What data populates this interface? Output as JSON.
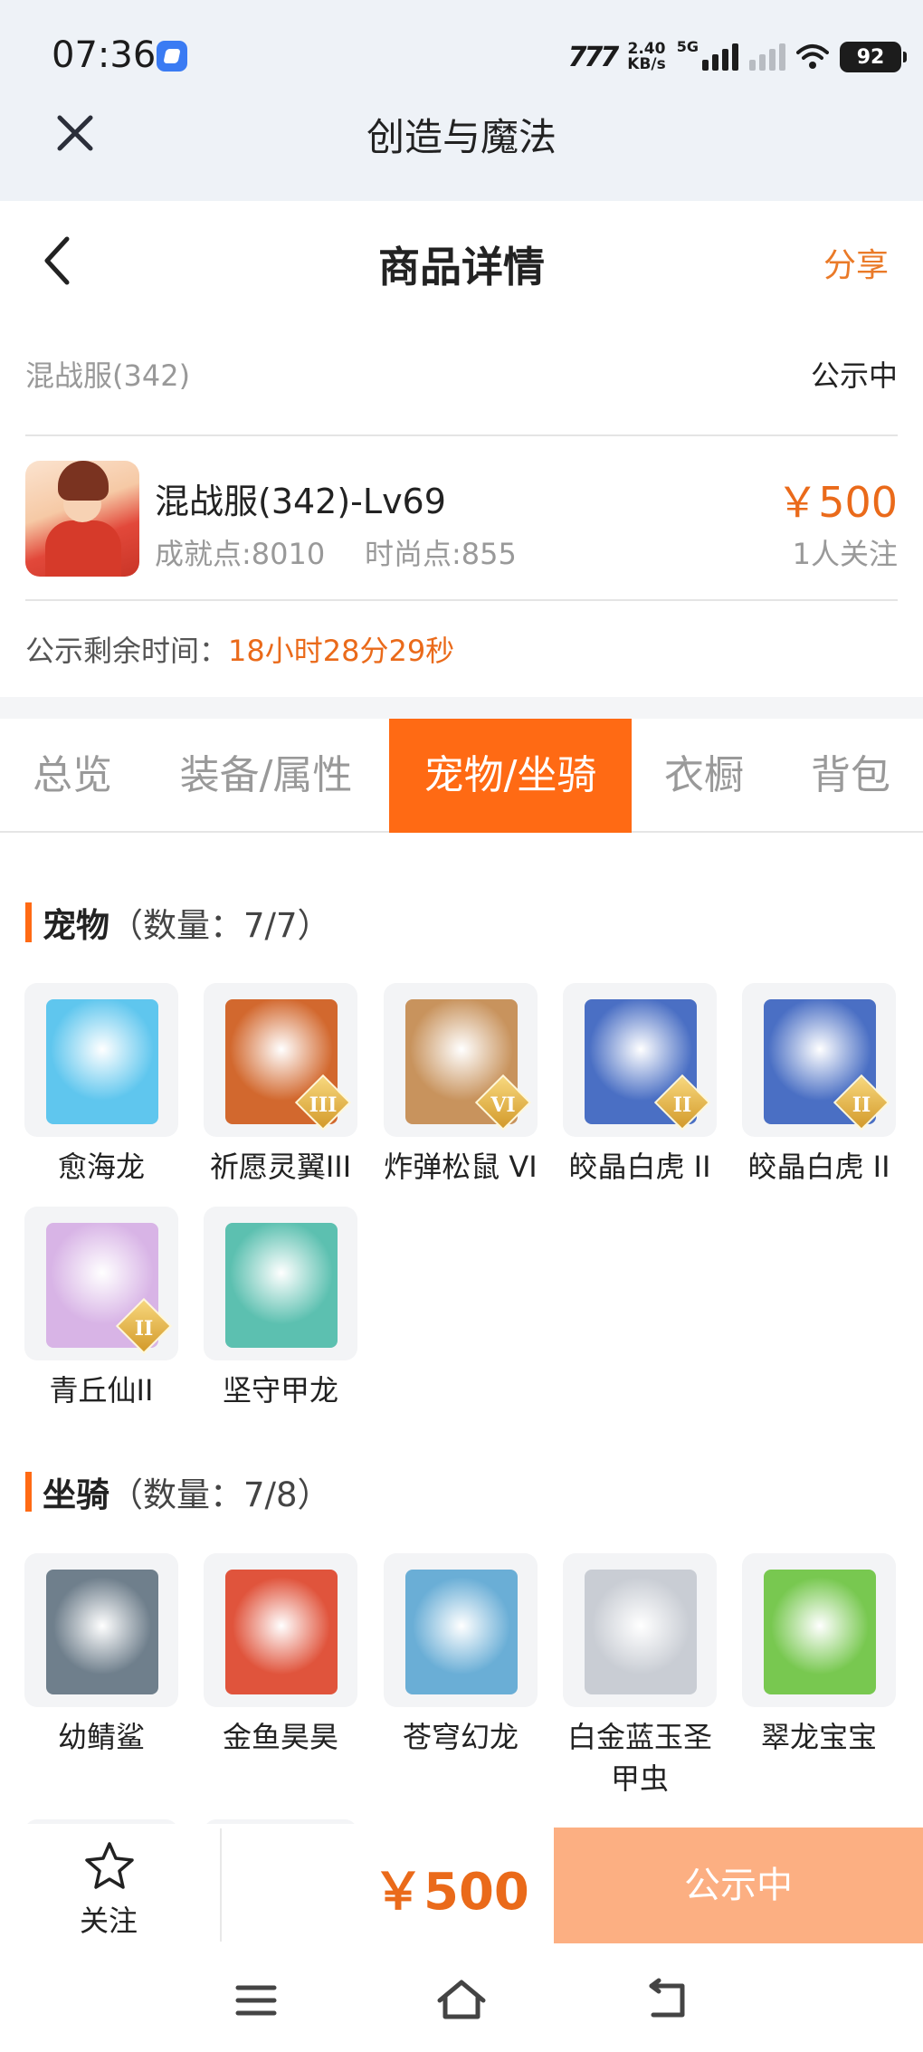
{
  "status_bar": {
    "time": "07:36",
    "signal_label": "777",
    "speed_value": "2.40",
    "speed_unit": "KB/s",
    "network": "5G",
    "battery": "92"
  },
  "app_bar": {
    "title": "创造与魔法",
    "close_icon": "close-icon"
  },
  "page_header": {
    "title": "商品详情",
    "share_label": "分享",
    "back_icon": "chevron-left-icon"
  },
  "product": {
    "server": "混战服(342)",
    "status": "公示中",
    "name": "混战服(342)-Lv69",
    "achievement": "成就点:8010",
    "fashion": "时尚点:855",
    "price": "￥500",
    "followers": "1人关注",
    "remaining_label": "公示剩余时间：",
    "remaining_value": "18小时28分29秒"
  },
  "tabs": [
    {
      "label": "总览",
      "active": false
    },
    {
      "label": "装备/属性",
      "active": false
    },
    {
      "label": "宠物/坐骑",
      "active": true
    },
    {
      "label": "衣橱",
      "active": false
    },
    {
      "label": "背包",
      "active": false
    }
  ],
  "pets": {
    "title": "宠物",
    "count": "（数量：7/7）",
    "items": [
      {
        "name": "愈海龙",
        "badge": "",
        "color": "#5fc6ee"
      },
      {
        "name": "祈愿灵翼III",
        "badge": "III",
        "color": "#d2682e"
      },
      {
        "name": "炸弹松鼠 VI",
        "badge": "VI",
        "color": "#c8935d"
      },
      {
        "name": "皎晶白虎 II",
        "badge": "II",
        "color": "#4a6fc4"
      },
      {
        "name": "皎晶白虎 II",
        "badge": "II",
        "color": "#4a6fc4"
      },
      {
        "name": "青丘仙II",
        "badge": "II",
        "color": "#d8b4e6"
      },
      {
        "name": "坚守甲龙",
        "badge": "",
        "color": "#5cc0b0"
      }
    ]
  },
  "mounts": {
    "title": "坐骑",
    "count": "（数量：7/8）",
    "items": [
      {
        "name": "幼鲭鲨",
        "color": "#6f7f8c"
      },
      {
        "name": "金鱼昊昊",
        "color": "#e0543c"
      },
      {
        "name": "苍穹幻龙",
        "color": "#6aaed6"
      },
      {
        "name": "白金蓝玉圣甲虫",
        "color": "#c9cdd4"
      },
      {
        "name": "翠龙宝宝",
        "color": "#78c850"
      }
    ]
  },
  "bottom_bar": {
    "follow_label": "关注",
    "price": "￥500",
    "status_button": "公示中"
  },
  "colors": {
    "accent": "#ff6a14",
    "price": "#ea6a1a",
    "status_button": "#fcaf82"
  }
}
